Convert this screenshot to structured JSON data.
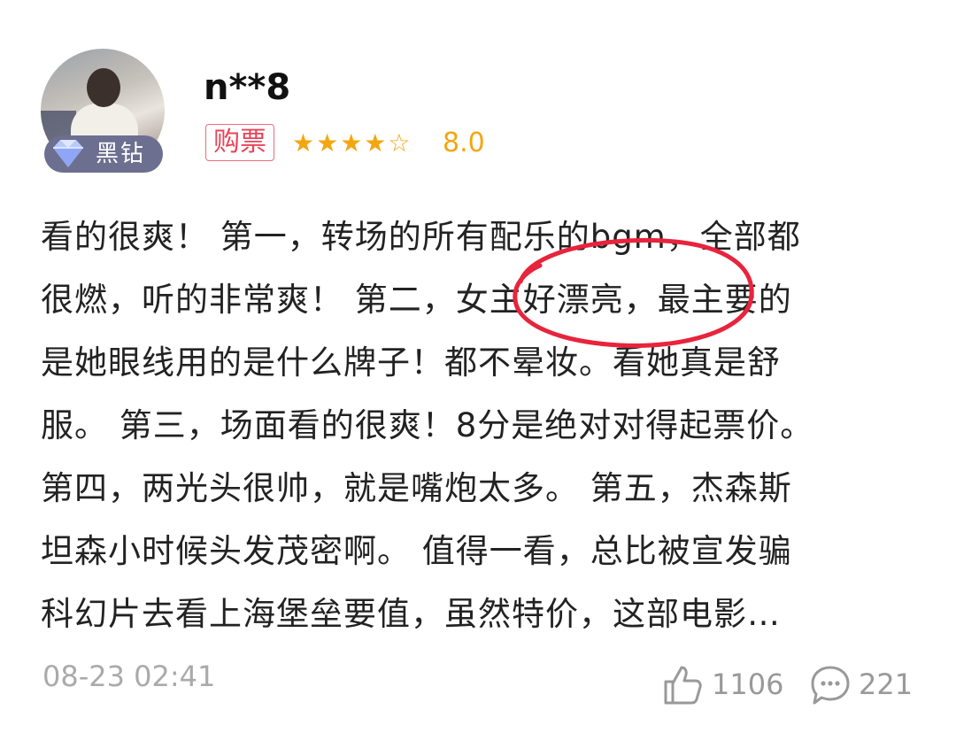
{
  "user": {
    "name": "n**8",
    "badge_label": "黑钻",
    "avatar_icon": "user-avatar-photo"
  },
  "rating": {
    "tag": "购票",
    "stars_display": "★★★★☆",
    "stars_value": 4,
    "score": "8.0",
    "accent_color": "#f3a60f"
  },
  "review": {
    "lines": [
      "看的很爽！ 第一，转场的所有配乐的bgm，全部都",
      "很燃，听的非常爽！ 第二，女主好漂亮，最主要的",
      "是她眼线用的是什么牌子！都不晕妆。看她真是舒",
      "服。 第三，场面看的很爽！8分是绝对对得起票价。",
      "第四，两光头很帅，就是嘴炮太多。 第五，杰森斯",
      "坦森小时候头发茂密啊。 值得一看，总比被宣发骗",
      "科幻片去看上海堡垒要值，虽然特价，这部电影…"
    ],
    "highlight_color": "#e8243c"
  },
  "footer": {
    "timestamp": "08-23 02:41",
    "likes": "1106",
    "comments": "221"
  }
}
